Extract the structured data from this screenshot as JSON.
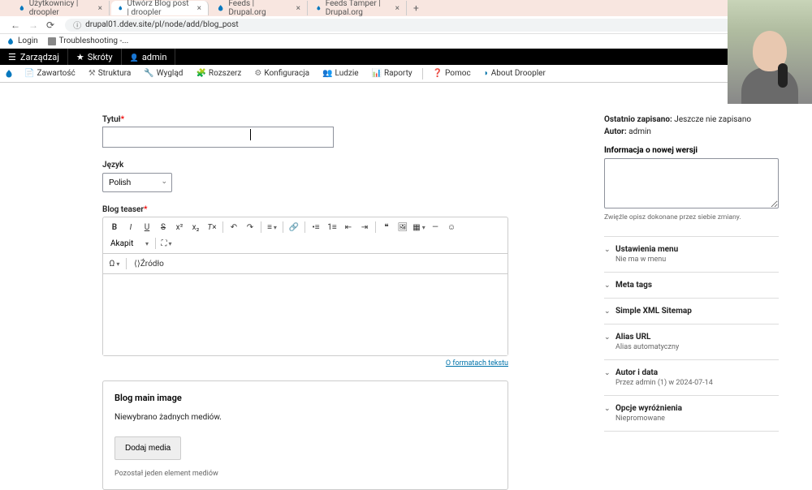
{
  "tabs": [
    {
      "label": "Użytkownicy | droopler"
    },
    {
      "label": "Utwórz Blog post | droopler",
      "active": true
    },
    {
      "label": "Feeds | Drupal.org"
    },
    {
      "label": "Feeds Tamper | Drupal.org"
    }
  ],
  "url": "drupal01.ddev.site/pl/node/add/blog_post",
  "bookmarks": [
    {
      "label": "Login"
    },
    {
      "label": "Troubleshooting -..."
    }
  ],
  "admin_bar": {
    "manage": "Zarządzaj",
    "shortcuts": "Skróty",
    "user": "admin"
  },
  "admin_bar_2": [
    "Zawartość",
    "Struktura",
    "Wygląd",
    "Rozszerz",
    "Konfiguracja",
    "Ludzie",
    "Raporty"
  ],
  "admin_bar_2_extra": [
    "Pomoc",
    "About Droopler"
  ],
  "form": {
    "title_label": "Tytuł",
    "language_label": "Język",
    "language_value": "Polish",
    "teaser_label": "Blog teaser",
    "style_dropdown": "Akapit",
    "source_label": "Źródło",
    "formats_link": "O formatach tekstu",
    "media_title": "Blog main image",
    "media_msg": "Niewybrano żadnych mediów.",
    "media_btn": "Dodaj media",
    "media_hint": "Pozostał jeden element mediów"
  },
  "sidebar": {
    "last_saved_label": "Ostatnio zapisano:",
    "last_saved_value": "Jeszcze nie zapisano",
    "author_label": "Autor:",
    "author_value": "admin",
    "revision_label": "Informacja o nowej wersji",
    "revision_hint": "Zwięźle opisz dokonane przez siebie zmiany.",
    "accordion": [
      {
        "title": "Ustawienia menu",
        "sub": "Nie ma w menu"
      },
      {
        "title": "Meta tags",
        "sub": ""
      },
      {
        "title": "Simple XML Sitemap",
        "sub": ""
      },
      {
        "title": "Alias URL",
        "sub": "Alias automatyczny"
      },
      {
        "title": "Autor i data",
        "sub": "Przez admin (1) w 2024-07-14"
      },
      {
        "title": "Opcje wyróżnienia",
        "sub": "Niepromowane"
      }
    ]
  }
}
